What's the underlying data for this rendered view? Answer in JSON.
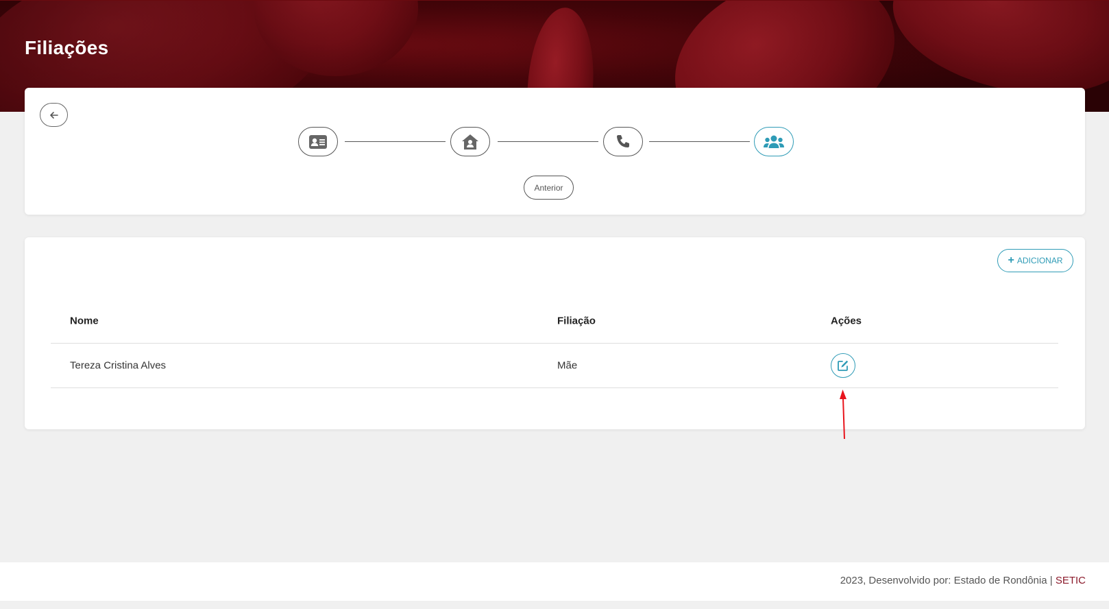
{
  "header": {
    "title": "Filiações"
  },
  "stepper": {
    "steps": [
      {
        "icon": "id-card-icon",
        "active": false
      },
      {
        "icon": "house-user-icon",
        "active": false
      },
      {
        "icon": "phone-icon",
        "active": false
      },
      {
        "icon": "users-icon",
        "active": true
      }
    ],
    "previous_label": "Anterior",
    "back_icon": "arrow-left-icon"
  },
  "table": {
    "add_label": "ADICIONAR",
    "columns": [
      "Nome",
      "Filiação",
      "Ações"
    ],
    "rows": [
      {
        "nome": "Tereza Cristina Alves",
        "filiacao": "Mãe",
        "action_icon": "edit-icon"
      }
    ]
  },
  "footer": {
    "text": "2023, Desenvolvido por: Estado de Rondônia | ",
    "link": "SETIC"
  },
  "colors": {
    "accent": "#2e9bb6",
    "brand": "#8b1a2b",
    "annotation_arrow": "#e8141c"
  }
}
